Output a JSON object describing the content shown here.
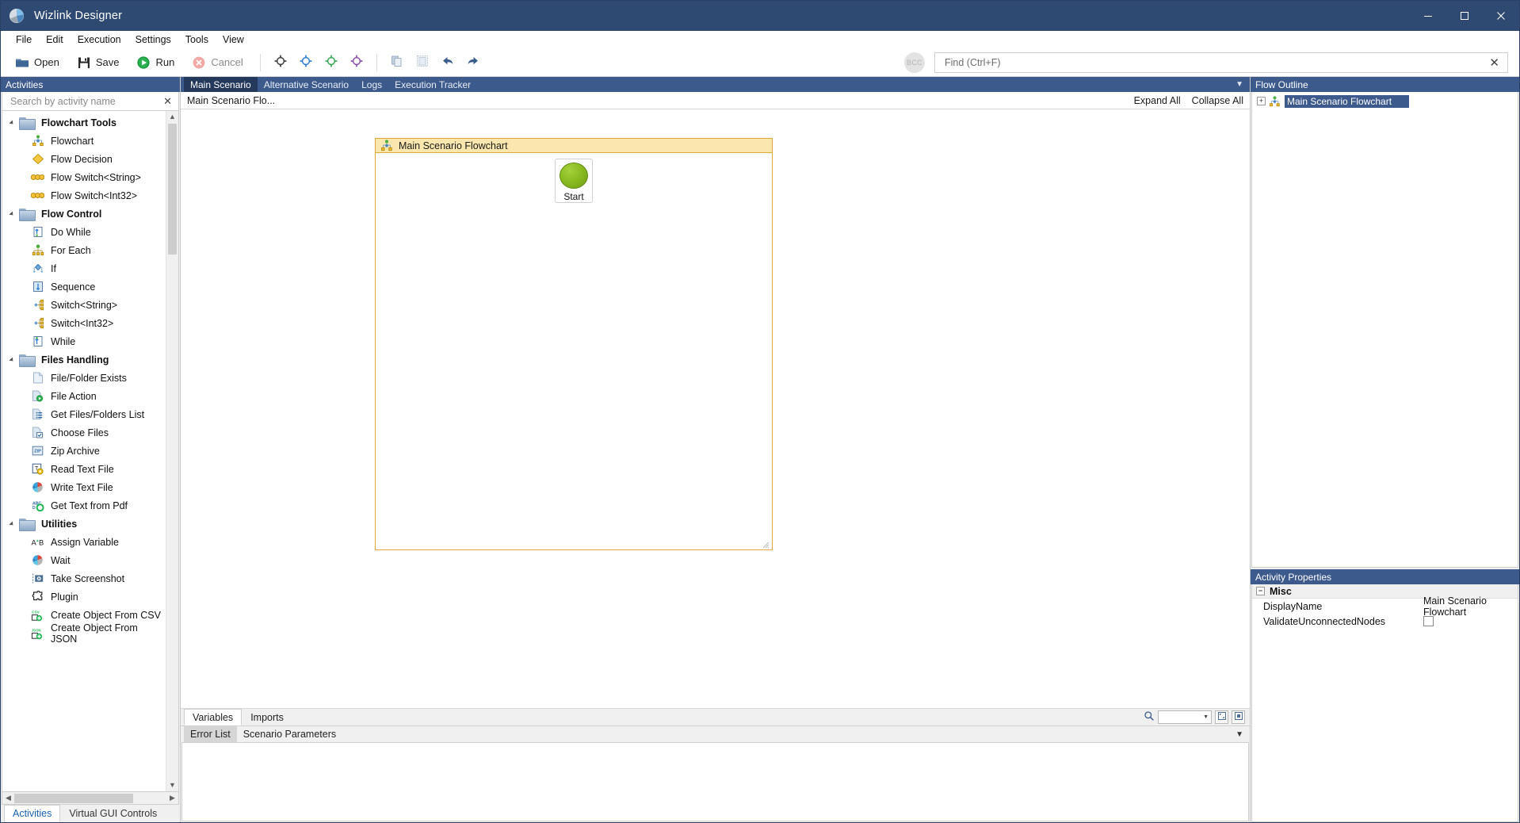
{
  "window": {
    "title": "Wizlink Designer",
    "logo_icon": "wizlink-logo-icon",
    "minimize": "─",
    "maximize": "☐",
    "close": "✕"
  },
  "menubar": {
    "items": [
      {
        "label": "File"
      },
      {
        "label": "Edit"
      },
      {
        "label": "Execution"
      },
      {
        "label": "Settings"
      },
      {
        "label": "Tools"
      },
      {
        "label": "View"
      }
    ]
  },
  "toolbar": {
    "open_label": "Open",
    "save_label": "Save",
    "run_label": "Run",
    "cancel_label": "Cancel",
    "icons": [
      {
        "name": "target-black-icon",
        "color": "#3d3d3d"
      },
      {
        "name": "target-blue-icon",
        "color": "#2f7fd1"
      },
      {
        "name": "target-green-icon",
        "color": "#35a853"
      },
      {
        "name": "target-purple-icon",
        "color": "#8e4fae"
      },
      {
        "name": "copy-icon",
        "color": "#8aa3bf"
      },
      {
        "name": "paste-icon",
        "color": "#b7c4d2"
      },
      {
        "name": "undo-icon",
        "color": "#3a5e8c"
      },
      {
        "name": "redo-icon",
        "color": "#3a5e8c"
      }
    ],
    "avatar_initials": "BCC",
    "find_placeholder": "Find (Ctrl+F)",
    "find_value": "",
    "find_clear": "✕"
  },
  "activities_panel": {
    "header": "Activities",
    "search_placeholder": "Search by activity name",
    "search_value": "",
    "search_clear": "✕",
    "groups": [
      {
        "label": "Flowchart Tools",
        "items": [
          {
            "label": "Flowchart",
            "icon": "flowchart-icon"
          },
          {
            "label": "Flow Decision",
            "icon": "diamond-icon"
          },
          {
            "label": "Flow Switch<String>",
            "icon": "flow-switch-icon"
          },
          {
            "label": "Flow Switch<Int32>",
            "icon": "flow-switch-icon"
          }
        ]
      },
      {
        "label": "Flow Control",
        "items": [
          {
            "label": "Do While",
            "icon": "do-while-icon"
          },
          {
            "label": "For Each",
            "icon": "for-each-icon"
          },
          {
            "label": "If",
            "icon": "if-icon"
          },
          {
            "label": "Sequence",
            "icon": "sequence-icon"
          },
          {
            "label": "Switch<String>",
            "icon": "switch-icon"
          },
          {
            "label": "Switch<Int32>",
            "icon": "switch-icon"
          },
          {
            "label": "While",
            "icon": "while-icon"
          }
        ]
      },
      {
        "label": "Files Handling",
        "items": [
          {
            "label": "File/Folder Exists",
            "icon": "file-icon"
          },
          {
            "label": "File Action",
            "icon": "file-action-icon"
          },
          {
            "label": "Get Files/Folders List",
            "icon": "file-list-icon"
          },
          {
            "label": "Choose Files",
            "icon": "choose-files-icon"
          },
          {
            "label": "Zip Archive",
            "icon": "zip-icon"
          },
          {
            "label": "Read Text File",
            "icon": "read-text-icon"
          },
          {
            "label": "Write Text File",
            "icon": "write-text-icon"
          },
          {
            "label": "Get Text from Pdf",
            "icon": "pdf-text-icon"
          }
        ]
      },
      {
        "label": "Utilities",
        "items": [
          {
            "label": "Assign Variable",
            "icon": "assign-variable-icon"
          },
          {
            "label": "Wait",
            "icon": "wait-icon"
          },
          {
            "label": "Take Screenshot",
            "icon": "screenshot-icon"
          },
          {
            "label": "Plugin",
            "icon": "puzzle-icon"
          },
          {
            "label": "Create Object From CSV",
            "icon": "csv-icon"
          },
          {
            "label": "Create Object From JSON",
            "icon": "json-icon"
          }
        ]
      }
    ],
    "bottom_tabs": [
      {
        "label": "Activities",
        "active": true
      },
      {
        "label": "Virtual GUI Controls",
        "active": false
      }
    ]
  },
  "document_tabs": [
    {
      "label": "Main Scenario",
      "active": true
    },
    {
      "label": "Alternative Scenario",
      "active": false
    },
    {
      "label": "Logs",
      "active": false
    },
    {
      "label": "Execution Tracker",
      "active": false
    }
  ],
  "breadcrumb": {
    "path": "Main Scenario Flo...",
    "expand_all": "Expand All",
    "collapse_all": "Collapse All"
  },
  "canvas": {
    "flowchart_title": "Main Scenario Flowchart",
    "flowchart_icon": "flowchart-icon",
    "start_node_label": "Start"
  },
  "variables_strip": {
    "tabs": [
      {
        "label": "Variables",
        "active": true
      },
      {
        "label": "Imports",
        "active": false
      }
    ],
    "search_icon": "magnifier-icon",
    "combo_value": "",
    "zoom_fit_icon": "zoom-fit-icon",
    "zoom_reset_icon": "zoom-reset-icon"
  },
  "error_strip": {
    "tabs": [
      {
        "label": "Error List",
        "active": true
      },
      {
        "label": "Scenario Parameters",
        "active": false
      }
    ]
  },
  "flow_outline": {
    "header": "Flow Outline",
    "node_label": "Main Scenario Flowchart",
    "node_icon": "flowchart-icon",
    "expander": "+"
  },
  "activity_properties": {
    "header": "Activity Properties",
    "group_label": "Misc",
    "group_expander": "−",
    "rows": [
      {
        "name": "DisplayName",
        "value": "Main Scenario Flowchart",
        "type": "text"
      },
      {
        "name": "ValidateUnconnectedNodes",
        "value": "",
        "type": "checkbox",
        "checked": false
      }
    ]
  },
  "colors": {
    "chrome_dark": "#2e4a72",
    "panel_header": "#3c5a8c",
    "accent_yellow": "#fbe6ad",
    "accent_yellow_border": "#e0a93b",
    "start_green": "#8cbe22"
  }
}
